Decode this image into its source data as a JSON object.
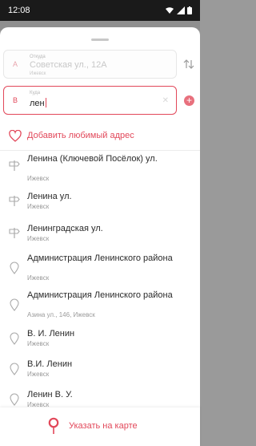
{
  "status_bar": {
    "time": "12:08"
  },
  "from_field": {
    "letter": "A",
    "caption": "Откуда",
    "value": "Советская ул., 12А",
    "city": "Ижевск"
  },
  "to_field": {
    "letter": "B",
    "caption": "Куда",
    "value": "лен"
  },
  "favorite": {
    "label": "Добавить любимый адрес"
  },
  "results": [
    {
      "title": "Ленина (Ключевой Посёлок) ул.",
      "subtitle": "Ижевск",
      "icon": "street-sign-icon"
    },
    {
      "title": "Ленина ул.",
      "subtitle": "Ижевск",
      "icon": "street-sign-icon"
    },
    {
      "title": "Ленинградская ул.",
      "subtitle": "Ижевск",
      "icon": "street-sign-icon"
    },
    {
      "title": "Администрация Ленинского района",
      "subtitle": "Ижевск",
      "icon": "location-pin-icon"
    },
    {
      "title": "Администрация Ленинского района",
      "subtitle": "Азина ул., 146, Ижевск",
      "icon": "location-pin-icon"
    },
    {
      "title": "В. И. Ленин",
      "subtitle": "Ижевск",
      "icon": "location-pin-icon"
    },
    {
      "title": "В.И. Ленин",
      "subtitle": "Ижевск",
      "icon": "location-pin-icon"
    },
    {
      "title": "Ленин В. У.",
      "subtitle": "Ижевск",
      "icon": "location-pin-icon"
    }
  ],
  "bottom": {
    "label": "Указать на карте"
  },
  "colors": {
    "accent": "#e2485a",
    "muted": "#9a9a9a"
  }
}
